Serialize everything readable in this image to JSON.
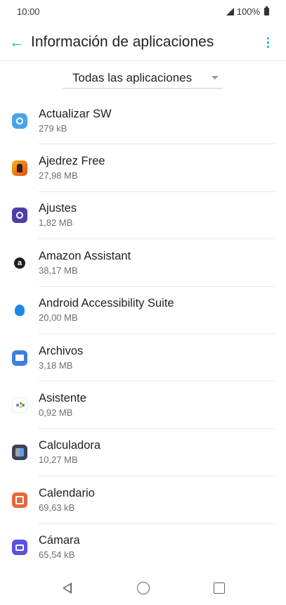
{
  "status_bar": {
    "time": "10:00",
    "battery": "100%"
  },
  "app_bar": {
    "title": "Información de aplicaciones"
  },
  "filter": {
    "selected": "Todas las aplicaciones"
  },
  "apps": [
    {
      "name": "Actualizar SW",
      "size": "279 kB",
      "icon": "update-sw-icon"
    },
    {
      "name": "Ajedrez Free",
      "size": "27,98 MB",
      "icon": "chess-icon"
    },
    {
      "name": "Ajustes",
      "size": "1,82 MB",
      "icon": "settings-icon"
    },
    {
      "name": "Amazon Assistant",
      "size": "38,17 MB",
      "icon": "amazon-icon"
    },
    {
      "name": "Android Accessibility Suite",
      "size": "20,00 MB",
      "icon": "accessibility-icon"
    },
    {
      "name": "Archivos",
      "size": "3,18 MB",
      "icon": "files-icon"
    },
    {
      "name": "Asistente",
      "size": "0,92 MB",
      "icon": "assistant-icon"
    },
    {
      "name": "Calculadora",
      "size": "10,27 MB",
      "icon": "calculator-icon"
    },
    {
      "name": "Calendario",
      "size": "69,63 kB",
      "icon": "calendar-icon"
    },
    {
      "name": "Cámara",
      "size": "65,54 kB",
      "icon": "camera-icon"
    }
  ],
  "colors": {
    "accent": "#1aa3c9"
  }
}
